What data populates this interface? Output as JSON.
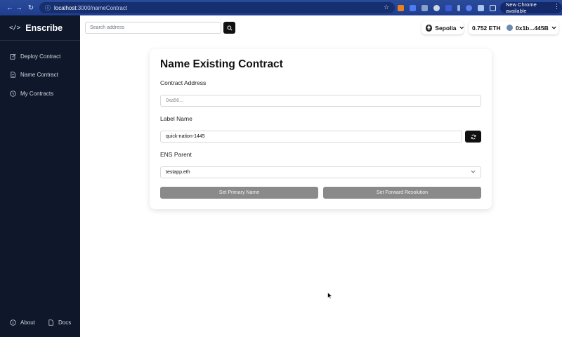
{
  "browser": {
    "url_host": "localhost",
    "url_rest": ":3000/nameContract",
    "update_label": "New Chrome available"
  },
  "sidebar": {
    "brand": "Enscribe",
    "brand_icon": "</>",
    "items": [
      {
        "label": "Deploy Contract",
        "icon": "edit-icon"
      },
      {
        "label": "Name Contract",
        "icon": "document-icon"
      },
      {
        "label": "My Contracts",
        "icon": "clock-icon"
      }
    ],
    "footer": [
      {
        "label": "About",
        "icon": "info-icon"
      },
      {
        "label": "Docs",
        "icon": "document-icon"
      }
    ]
  },
  "topbar": {
    "search_placeholder": "Search address",
    "network": "Sepolia",
    "balance": "0.752 ETH",
    "account": "0x1b...445B"
  },
  "form": {
    "title": "Name Existing Contract",
    "contract_address_label": "Contract Address",
    "contract_address_placeholder": "0xa56...",
    "label_name_label": "Label Name",
    "label_name_value": "quick-nation-1445",
    "ens_parent_label": "ENS Parent",
    "ens_parent_value": "testapp.eth",
    "primary_button": "Set Primary Name",
    "forward_button": "Set Forward Resolution"
  }
}
